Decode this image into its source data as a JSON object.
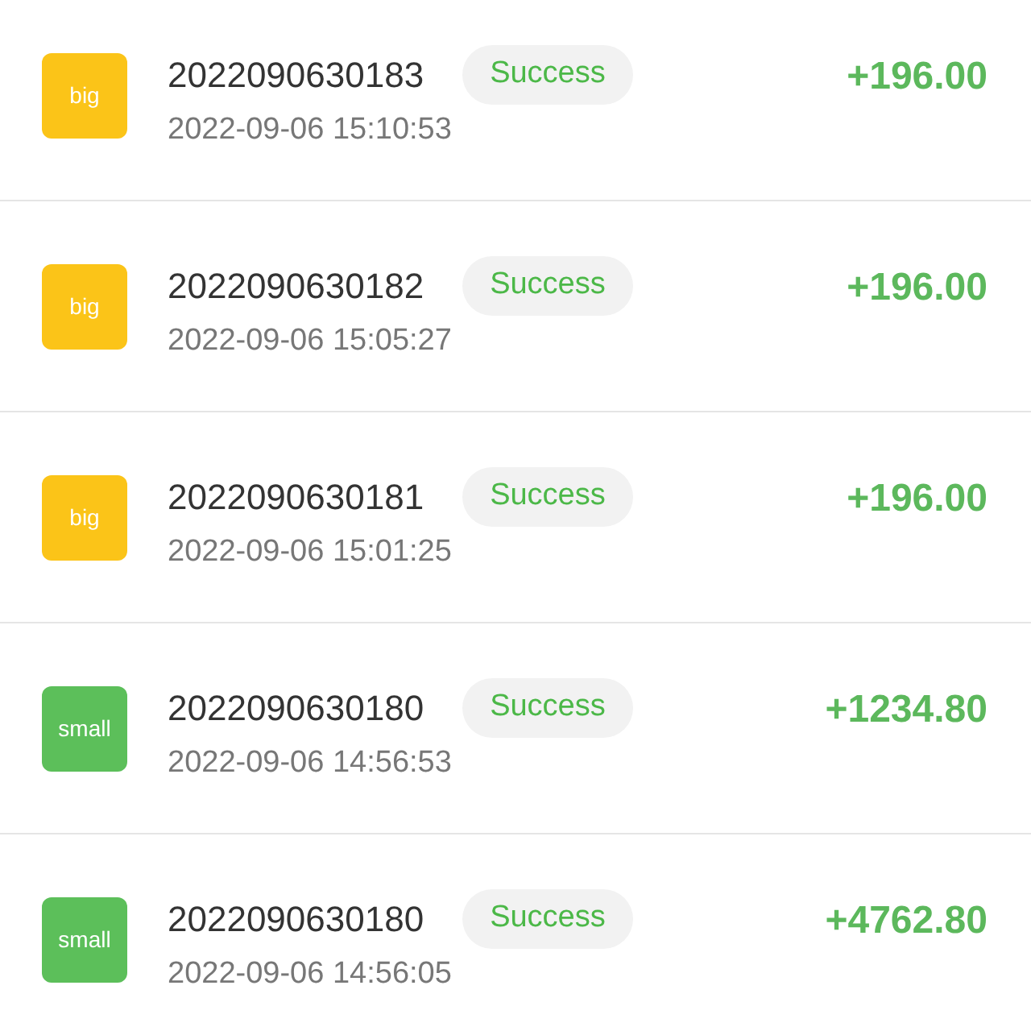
{
  "transactions": [
    {
      "kind": "big",
      "badge": "big",
      "order": "2022090630183",
      "status": "Success",
      "time": "2022-09-06 15:10:53",
      "amount": "+196.00"
    },
    {
      "kind": "big",
      "badge": "big",
      "order": "2022090630182",
      "status": "Success",
      "time": "2022-09-06 15:05:27",
      "amount": "+196.00"
    },
    {
      "kind": "big",
      "badge": "big",
      "order": "2022090630181",
      "status": "Success",
      "time": "2022-09-06 15:01:25",
      "amount": "+196.00"
    },
    {
      "kind": "small",
      "badge": "small",
      "order": "2022090630180",
      "status": "Success",
      "time": "2022-09-06 14:56:53",
      "amount": "+1234.80"
    },
    {
      "kind": "small",
      "badge": "small",
      "order": "2022090630180",
      "status": "Success",
      "time": "2022-09-06 14:56:05",
      "amount": "+4762.80"
    }
  ]
}
